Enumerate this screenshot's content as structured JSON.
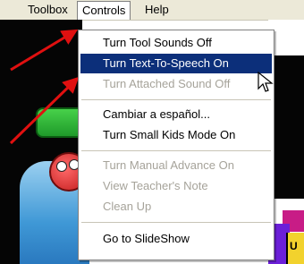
{
  "menubar": {
    "items": [
      {
        "label": "Toolbox",
        "selected": false
      },
      {
        "label": "Controls",
        "selected": true
      },
      {
        "label": "Help",
        "selected": false
      }
    ]
  },
  "controls_menu": {
    "items": [
      {
        "label": "Turn Tool Sounds Off",
        "state": "enabled"
      },
      {
        "label": "Turn Text-To-Speech On",
        "state": "highlighted"
      },
      {
        "label": "Turn Attached Sound Off",
        "state": "disabled"
      },
      {
        "separator": true
      },
      {
        "label": "Cambiar a español...",
        "state": "enabled"
      },
      {
        "label": "Turn Small Kids Mode On",
        "state": "enabled"
      },
      {
        "separator": true
      },
      {
        "label": "Turn Manual Advance On",
        "state": "disabled"
      },
      {
        "label": "View Teacher's Note",
        "state": "disabled"
      },
      {
        "label": "Clean Up",
        "state": "disabled"
      },
      {
        "separator": true
      },
      {
        "label": "Go to SlideShow",
        "state": "enabled"
      }
    ]
  },
  "background_tile_text": "U",
  "colors": {
    "menu_highlight": "#0c2f7a",
    "disabled_text": "#a6a39a",
    "arrow": "#e01010"
  }
}
